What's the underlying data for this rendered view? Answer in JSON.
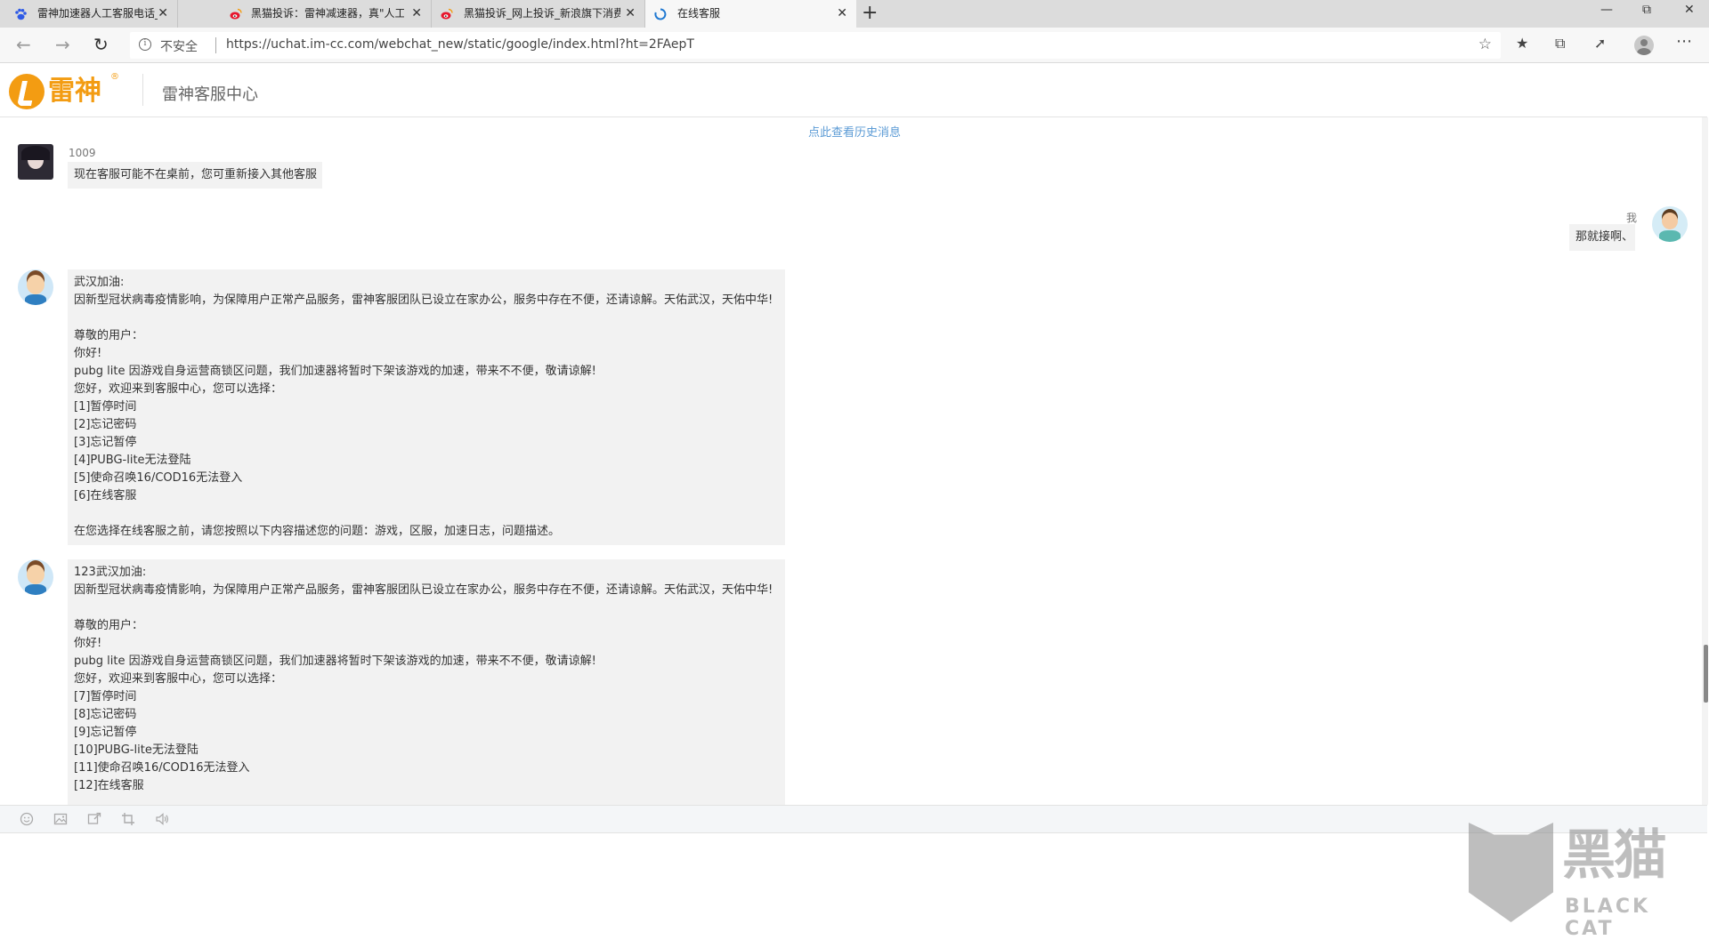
{
  "browser": {
    "tabs": [
      {
        "title": "雷神加速器人工客服电话_百度搜",
        "favicon": "baidu-paw-icon",
        "active": false
      },
      {
        "title": "黑猫投诉：雷神减速器，真\"人工",
        "favicon": "weibo-icon",
        "active": false
      },
      {
        "title": "黑猫投诉_网上投诉_新浪旗下消费",
        "favicon": "weibo-icon",
        "active": false
      },
      {
        "title": "在线客服",
        "favicon": "edge-loading-icon",
        "active": true
      }
    ],
    "new_tab": "+",
    "close_glyph": "✕",
    "security_label": "不安全",
    "url": "https://uchat.im-cc.com/webchat_new/static/google/index.html?ht=2FAepT"
  },
  "header": {
    "brand": "雷神",
    "reg_mark": "®",
    "title": "雷神客服中心"
  },
  "chat": {
    "history_link": "点此查看历史消息",
    "messages": [
      {
        "sender": "1009",
        "lines": [
          "现在客服可能不在桌前，您可重新接入其他客服"
        ]
      },
      {
        "sender": "我",
        "lines": [
          "那就接啊、"
        ]
      },
      {
        "sender": "",
        "lines": [
          "武汉加油:",
          "因新型冠状病毒疫情影响，为保障用户正常产品服务，雷神客服团队已设立在家办公，服务中存在不便，还请谅解。天佑武汉，天佑中华!",
          "",
          "尊敬的用户：",
          "你好!",
          "pubg lite 因游戏自身运营商锁区问题，我们加速器将暂时下架该游戏的加速，带来不不便，敬请谅解!",
          "您好，欢迎来到客服中心，您可以选择：",
          "[1]暂停时间",
          "[2]忘记密码",
          "[3]忘记暂停",
          "[4]PUBG-lite无法登陆",
          "[5]使命召唤16/COD16无法登入",
          "[6]在线客服",
          "",
          "在您选择在线客服之前，请您按照以下内容描述您的问题：游戏，区服，加速日志，问题描述。"
        ]
      },
      {
        "sender": "",
        "lines": [
          "123武汉加油:",
          "因新型冠状病毒疫情影响，为保障用户正常产品服务，雷神客服团队已设立在家办公，服务中存在不便，还请谅解。天佑武汉，天佑中华!",
          "",
          "尊敬的用户：",
          "你好!",
          "pubg lite 因游戏自身运营商锁区问题，我们加速器将暂时下架该游戏的加速，带来不不便，敬请谅解!",
          "您好，欢迎来到客服中心，您可以选择：",
          "[7]暂停时间",
          "[8]忘记密码",
          "[9]忘记暂停",
          "[10]PUBG-lite无法登陆",
          "[11]使命召唤16/COD16无法登入",
          "[12]在线客服"
        ]
      }
    ]
  },
  "composer": {
    "tools": [
      "emoji-icon",
      "image-icon",
      "screenshot-share-icon",
      "crop-icon",
      "voice-icon"
    ]
  },
  "watermark": {
    "cn": "黑猫",
    "en": "BLACK CAT"
  },
  "colors": {
    "brand_orange": "#f39c12",
    "link_blue": "#5b9bd5",
    "bubble_gray": "#f2f2f2"
  }
}
